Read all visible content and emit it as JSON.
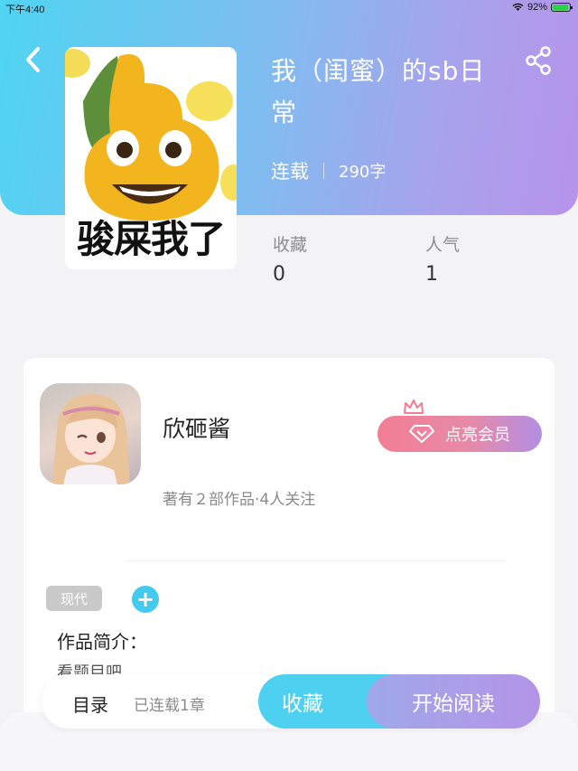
{
  "status_bar": {
    "time": "下午4:40",
    "battery": "92%",
    "battery_level": 0.92
  },
  "book": {
    "cover_text": "骏屎我了",
    "title": "我（闺蜜）的sb日常",
    "status": "连载",
    "word_count": "290字",
    "stats": [
      {
        "label": "收藏",
        "value": "0"
      },
      {
        "label": "人气",
        "value": "1"
      }
    ]
  },
  "author": {
    "name": "欣砸酱",
    "description": "著有２部作品·4人关注",
    "vip_label": "点亮会员"
  },
  "tags": [
    "现代"
  ],
  "tag_add": "+",
  "intro": {
    "label": "作品简介：",
    "text": "看题目吧"
  },
  "bottom_bar": {
    "toc_label": "目录",
    "chapters_label": "已连载1章",
    "collect_label": "收藏",
    "read_label": "开始阅读"
  },
  "colors": {
    "accent": "#4ed0f0",
    "gradient_start": "#4fd4f1",
    "gradient_end": "#b793ea",
    "vip_start": "#f37e94"
  },
  "icons": [
    "back-arrow-icon",
    "share-icon",
    "crown-icon",
    "diamond-icon",
    "wifi-icon",
    "battery-icon"
  ]
}
